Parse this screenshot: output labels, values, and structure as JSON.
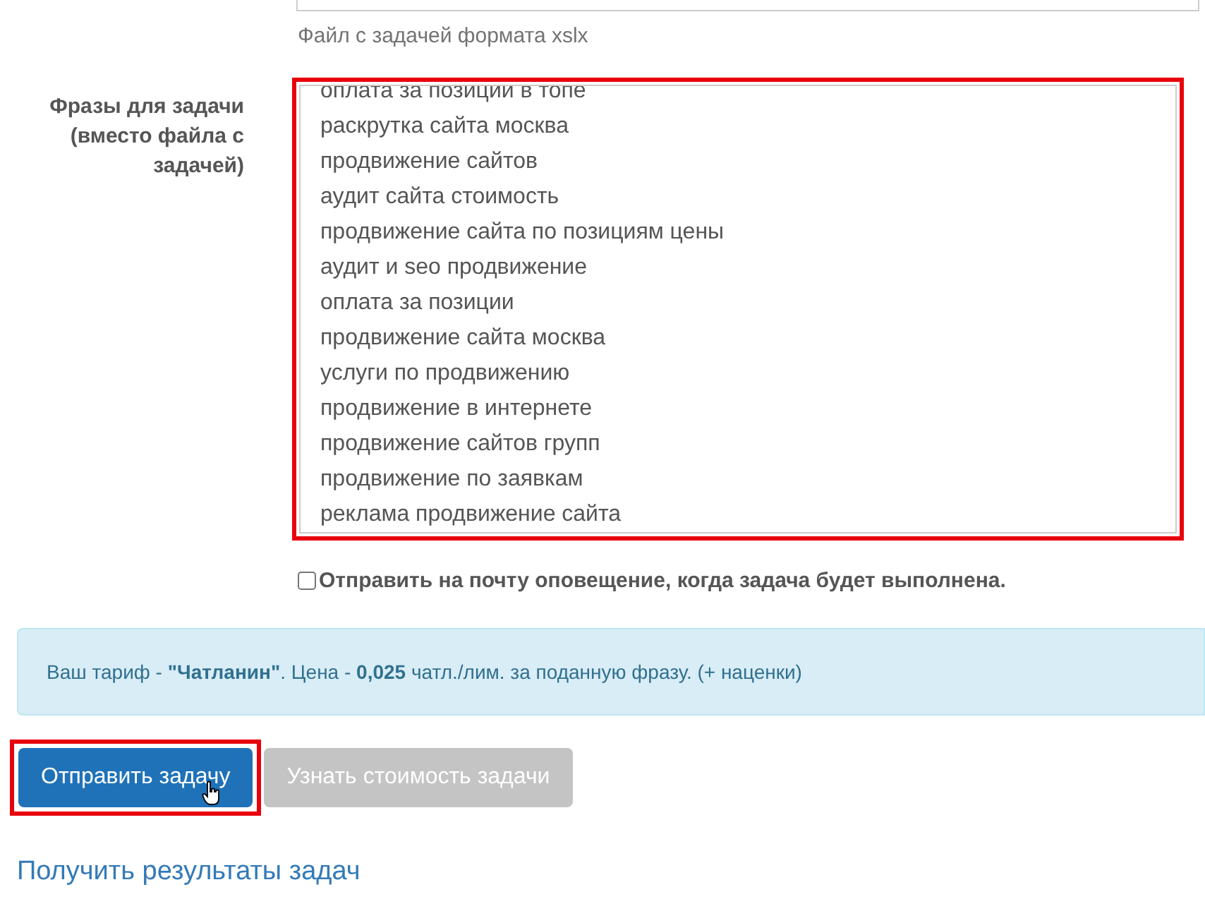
{
  "file_field": {
    "hint": "Файл с задачей формата xslx"
  },
  "phrases": {
    "label": "Фразы для задачи (вместо файла с задачей)",
    "highlighted": true,
    "lines": [
      "оплата за позиции в топе",
      "раскрутка сайта москва",
      "продвижение сайтов",
      "аудит сайта стоимость",
      "продвижение сайта по позициям цены",
      "аудит и seo продвижение",
      "оплата за позиции",
      "продвижение сайта москва",
      "услуги по продвижению",
      "продвижение в интернете",
      "продвижение сайтов групп",
      "продвижение по заявкам",
      "реклама продвижение сайта"
    ]
  },
  "notify": {
    "label": "Отправить на почту оповещение, когда задача будет выполнена.",
    "checked": false
  },
  "tariff_info": "Ваш тариф - **\"Чатланин\"**. Цена - **0,025** чатл./лим. за поданную фразу. (+ наценки)",
  "buttons": [
    {
      "label": "Отправить задачу",
      "kind": "primary",
      "highlighted": true
    },
    {
      "label": "Узнать стоимость задачи",
      "kind": "disabled",
      "highlighted": false
    }
  ],
  "results_link": "Получить результаты задач"
}
